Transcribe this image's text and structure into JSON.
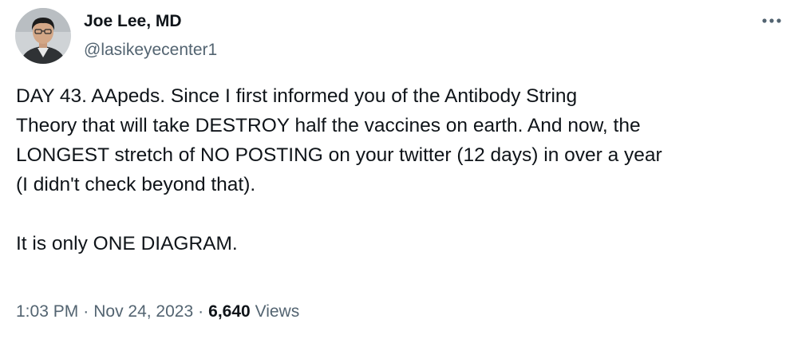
{
  "tweet": {
    "author": {
      "display_name": "Joe Lee, MD",
      "handle": "@lasikeyecenter1",
      "avatar_icon": "profile-photo"
    },
    "more_icon": "more-horizontal-icon",
    "lines": [
      "DAY 43.  AApeds.  Since I first informed you of the Antibody String",
      "Theory that will take DESTROY half the vaccines on earth.   And now, the",
      "LONGEST stretch of NO POSTING on your twitter (12 days) in over a year",
      "(I didn't check beyond that).",
      "",
      "It is only ONE DIAGRAM."
    ],
    "time": "1:03 PM",
    "separator": "·",
    "date": "Nov 24, 2023",
    "views_count": "6,640",
    "views_label": "Views"
  },
  "colors": {
    "text_primary": "#0f1419",
    "text_secondary": "#536471",
    "background": "#ffffff"
  }
}
